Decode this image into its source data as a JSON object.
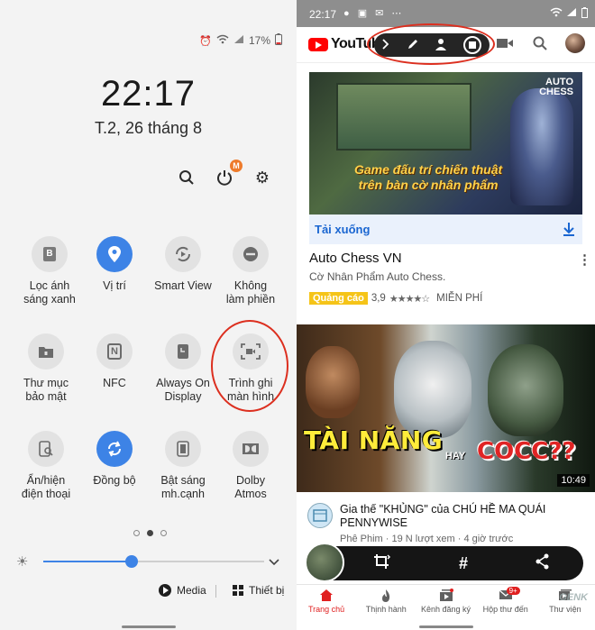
{
  "left": {
    "status": {
      "battery": "17%"
    },
    "time": "22:17",
    "date": "T.2, 26 tháng 8",
    "badges": {
      "timer": "M",
      "more": "M"
    },
    "tiles": [
      {
        "line1": "Lọc ánh",
        "line2": "sáng xanh",
        "glyph": "B",
        "on": false
      },
      {
        "line1": "Vị trí",
        "line2": "",
        "glyph": "pin",
        "on": true
      },
      {
        "line1": "Smart View",
        "line2": "",
        "glyph": "cast",
        "on": false
      },
      {
        "line1": "Không",
        "line2": "làm phiền",
        "glyph": "minus",
        "on": false
      },
      {
        "line1": "Thư mục",
        "line2": "bảo mật",
        "glyph": "folder",
        "on": false
      },
      {
        "line1": "NFC",
        "line2": "",
        "glyph": "N",
        "on": false
      },
      {
        "line1": "Always On",
        "line2": "Display",
        "glyph": "clock",
        "on": false
      },
      {
        "line1": "Trình ghi",
        "line2": "màn hình",
        "glyph": "record",
        "on": false
      },
      {
        "line1": "Ẩn/hiện",
        "line2": "điện thoại",
        "glyph": "phone",
        "on": false
      },
      {
        "line1": "Đồng bộ",
        "line2": "",
        "glyph": "sync",
        "on": true
      },
      {
        "line1": "Bật sáng",
        "line2": "mh.cạnh",
        "glyph": "edge",
        "on": false
      },
      {
        "line1": "Dolby",
        "line2": "Atmos",
        "glyph": "dolby",
        "on": false
      }
    ],
    "brightness": 0.4,
    "bottom": {
      "media": "Media",
      "devices": "Thiết bị"
    }
  },
  "right": {
    "status": {
      "time": "22:17"
    },
    "youtube_word": "YouTube",
    "ad": {
      "logo_line1": "AUTO",
      "logo_line2": "CHESS",
      "text_line1": "Game đấu trí chiến thuật",
      "text_line2": "trên bàn cờ nhân phẩm",
      "download": "Tải xuống",
      "app_title": "Auto Chess VN",
      "app_sub": "Cờ Nhân Phẩm Auto Chess.",
      "badge": "Quảng cáo",
      "rating": "3,9",
      "stars": "★★★★☆",
      "price": "MIỄN PHÍ"
    },
    "video": {
      "thumb_text1": "TÀI NĂNG",
      "thumb_text2": "HAY",
      "thumb_text3": "COCC??",
      "duration": "10:49",
      "title": "Gia thế \"KHỦNG\" của CHÚ HỀ MA QUÁI PENNYWISE",
      "channel": "Phê Phim",
      "meta": "Phê Phim · 19 N lượt xem · 4 giờ trước"
    },
    "nav": [
      {
        "label": "Trang chủ",
        "active": true
      },
      {
        "label": "Thịnh hành",
        "active": false
      },
      {
        "label": "Kênh đăng ký",
        "active": false
      },
      {
        "label": "Hộp thư đến",
        "active": false,
        "badge": "9+"
      },
      {
        "label": "Thư viện",
        "active": false
      }
    ],
    "watermark": "GENK"
  },
  "colors": {
    "accent": "#3d83e6",
    "youtube_red": "#ff0000",
    "highlight_circle": "#dc2f1f"
  }
}
